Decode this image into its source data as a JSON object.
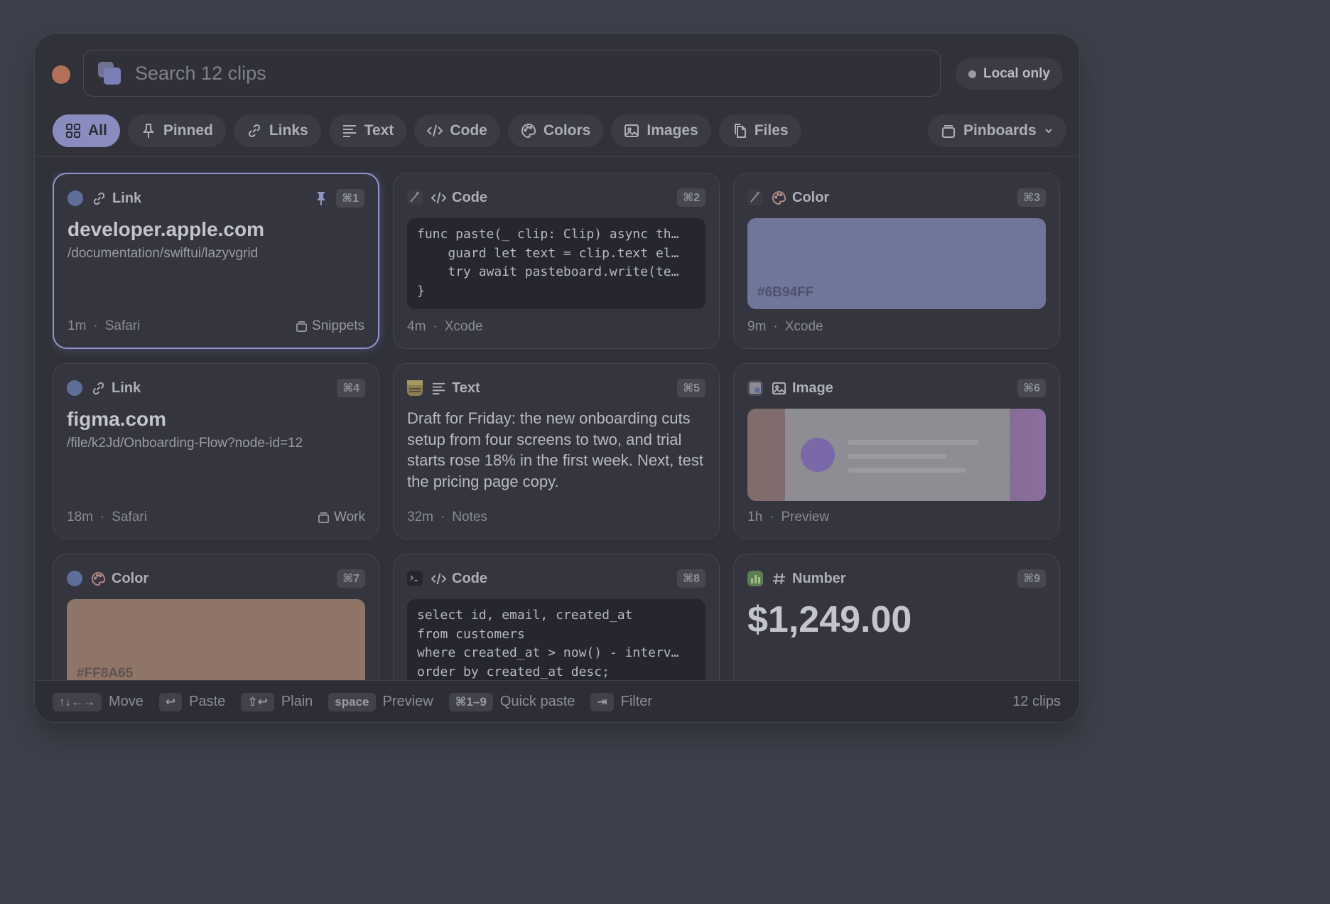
{
  "search": {
    "placeholder": "Search 12 clips"
  },
  "storage_badge": "Local only",
  "tabs": [
    {
      "label": "All",
      "icon": "grid-icon",
      "active": true
    },
    {
      "label": "Pinned",
      "icon": "pin-icon"
    },
    {
      "label": "Links",
      "icon": "link-icon"
    },
    {
      "label": "Text",
      "icon": "text-lines-icon"
    },
    {
      "label": "Code",
      "icon": "code-icon"
    },
    {
      "label": "Colors",
      "icon": "palette-icon"
    },
    {
      "label": "Images",
      "icon": "image-icon"
    },
    {
      "label": "Files",
      "icon": "files-icon"
    }
  ],
  "pinboards_label": "Pinboards",
  "clips": [
    {
      "type": "Link",
      "shortcut": "⌘1",
      "pinned": true,
      "title": "developer.apple.com",
      "path": "/documentation/swiftui/lazyvgrid",
      "age": "1m",
      "app": "Safari",
      "board": "Snippets",
      "source_icon": "safari-icon"
    },
    {
      "type": "Code",
      "shortcut": "⌘2",
      "code": "func paste(_ clip: Clip) async th…\n    guard let text = clip.text el…\n    try await pasteboard.write(te…\n}",
      "age": "4m",
      "app": "Xcode",
      "source_icon": "xcode-icon"
    },
    {
      "type": "Color",
      "shortcut": "⌘3",
      "hex": "#6B94FF",
      "age": "9m",
      "app": "Xcode",
      "source_icon": "xcode-icon"
    },
    {
      "type": "Link",
      "shortcut": "⌘4",
      "title": "figma.com",
      "path": "/file/k2Jd/Onboarding-Flow?node-id=12",
      "age": "18m",
      "app": "Safari",
      "board": "Work",
      "source_icon": "safari-icon"
    },
    {
      "type": "Text",
      "shortcut": "⌘5",
      "body": "Draft for Friday: the new onboarding cuts setup from four screens to two, and trial starts rose 18% in the first week. Next, test the pricing page copy.",
      "age": "32m",
      "app": "Notes",
      "source_icon": "notes-icon"
    },
    {
      "type": "Image",
      "shortcut": "⌘6",
      "age": "1h",
      "app": "Preview",
      "source_icon": "preview-icon"
    },
    {
      "type": "Color",
      "shortcut": "⌘7",
      "hex": "#FF8A65",
      "source_icon": "safari-icon"
    },
    {
      "type": "Code",
      "shortcut": "⌘8",
      "code": "select id, email, created_at\nfrom customers\nwhere created_at > now() - interv…\norder by created_at desc;",
      "source_icon": "terminal-icon"
    },
    {
      "type": "Number",
      "shortcut": "⌘9",
      "value": "$1,249.00",
      "source_icon": "numbers-icon"
    }
  ],
  "footer": {
    "hints": [
      {
        "key": "↑↓←→",
        "label": "Move"
      },
      {
        "key": "↩",
        "label": "Paste"
      },
      {
        "key": "⇧↩",
        "label": "Plain"
      },
      {
        "key": "space",
        "label": "Preview"
      },
      {
        "key": "⌘1–9",
        "label": "Quick paste"
      },
      {
        "key": "⇥",
        "label": "Filter"
      }
    ],
    "count": "12 clips"
  },
  "sep": "·",
  "colors": {
    "accent": "#8A8CC0",
    "swatch1": "#70769A",
    "swatch2": "#8E7567"
  }
}
